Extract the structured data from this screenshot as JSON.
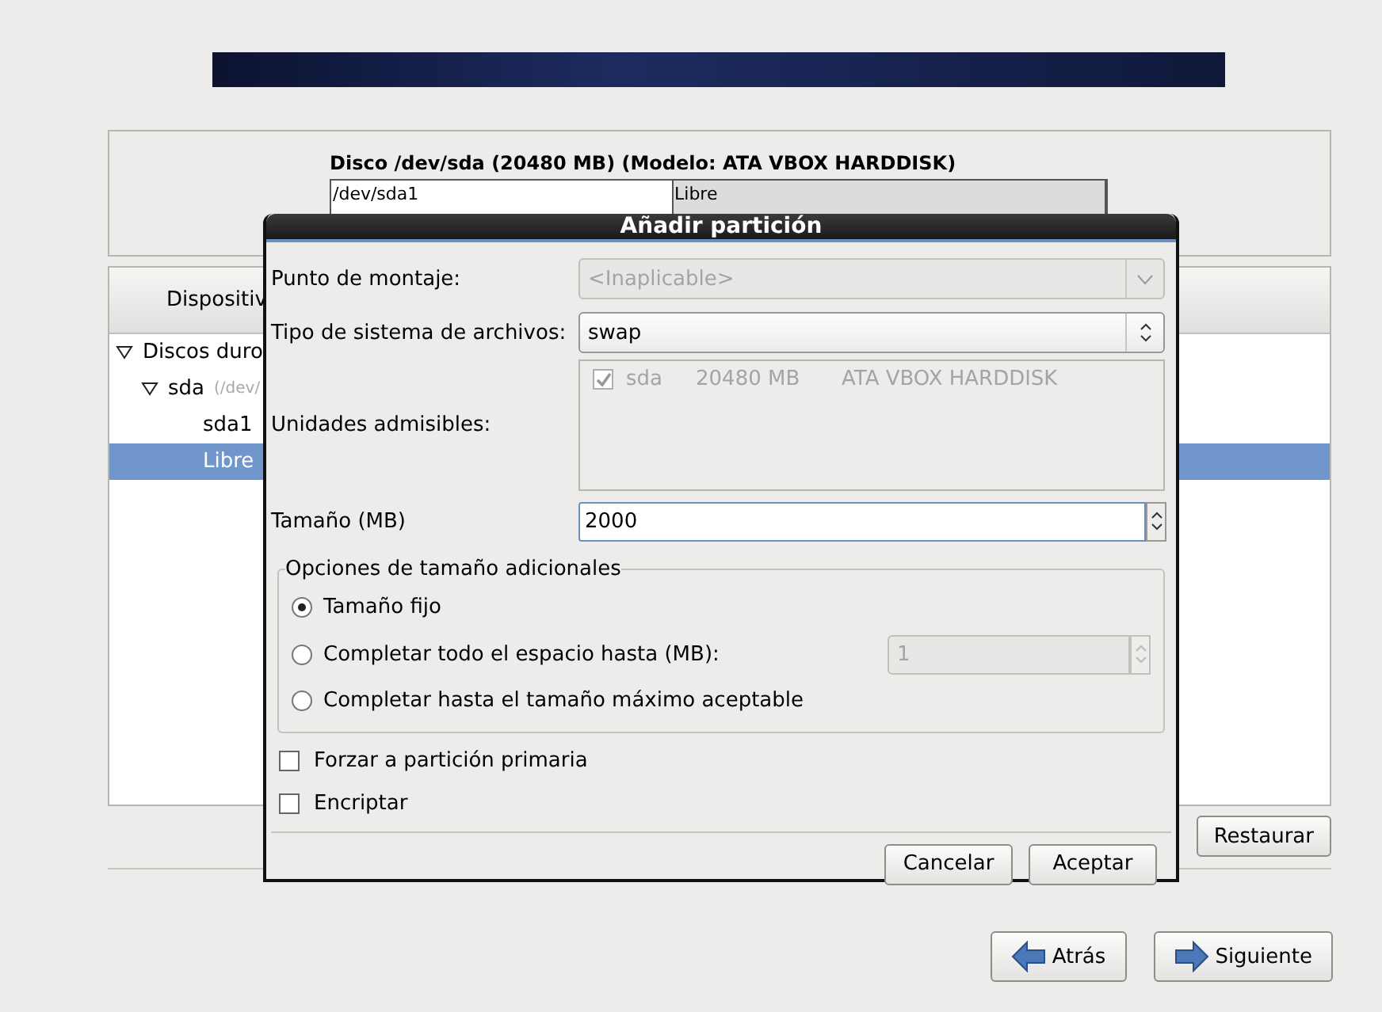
{
  "disk": {
    "title": "Disco /dev/sda (20480 MB) (Modelo: ATA VBOX HARDDISK)",
    "segments": [
      {
        "name": "/dev/sda1",
        "level": 0.44,
        "kind": "used"
      },
      {
        "name": "Libre",
        "level": 0.56,
        "kind": "free"
      }
    ]
  },
  "devices": {
    "header": "Dispositiv",
    "tree": [
      {
        "label": "Discos duro",
        "expanded": true,
        "selected": false,
        "children": [
          {
            "label": "sda",
            "detail": "(/dev/",
            "expanded": true,
            "selected": false,
            "children": [
              {
                "label": "sda1",
                "selected": false
              },
              {
                "label": "Libre",
                "selected": true
              }
            ]
          }
        ]
      }
    ]
  },
  "actions": [
    "Restaurar"
  ],
  "navigation": [
    {
      "label": "Atrás",
      "kind": "back"
    },
    {
      "label": "Siguiente",
      "kind": "next"
    }
  ],
  "dialog": {
    "title": "Añadir partición",
    "mount_point": {
      "label": "Punto de montaje:",
      "value": "<Inaplicable>",
      "disabled": true
    },
    "fs_type": {
      "label": "Tipo de sistema de archivos:",
      "value": "swap"
    },
    "drives": {
      "label": "Unidades admisibles:",
      "rows": [
        {
          "checked": true,
          "disabled": true,
          "name": "sda",
          "size": "20480 MB",
          "model": "ATA VBOX HARDDISK"
        }
      ]
    },
    "size": {
      "label": "Tamaño (MB)",
      "value": "2000"
    },
    "size_options": {
      "legend": "Opciones de tamaño adicionales",
      "options": [
        {
          "label": "Tamaño fijo",
          "selected": true
        },
        {
          "label": "Completar todo el espacio hasta (MB):",
          "selected": false,
          "value": "1",
          "disabled": true
        },
        {
          "label": "Completar hasta el tamaño máximo aceptable",
          "selected": false
        }
      ]
    },
    "checkboxes": [
      {
        "label": "Forzar a partición primaria",
        "checked": false
      },
      {
        "label": "Encriptar",
        "checked": false
      }
    ],
    "buttons": [
      "Cancelar",
      "Aceptar"
    ]
  }
}
